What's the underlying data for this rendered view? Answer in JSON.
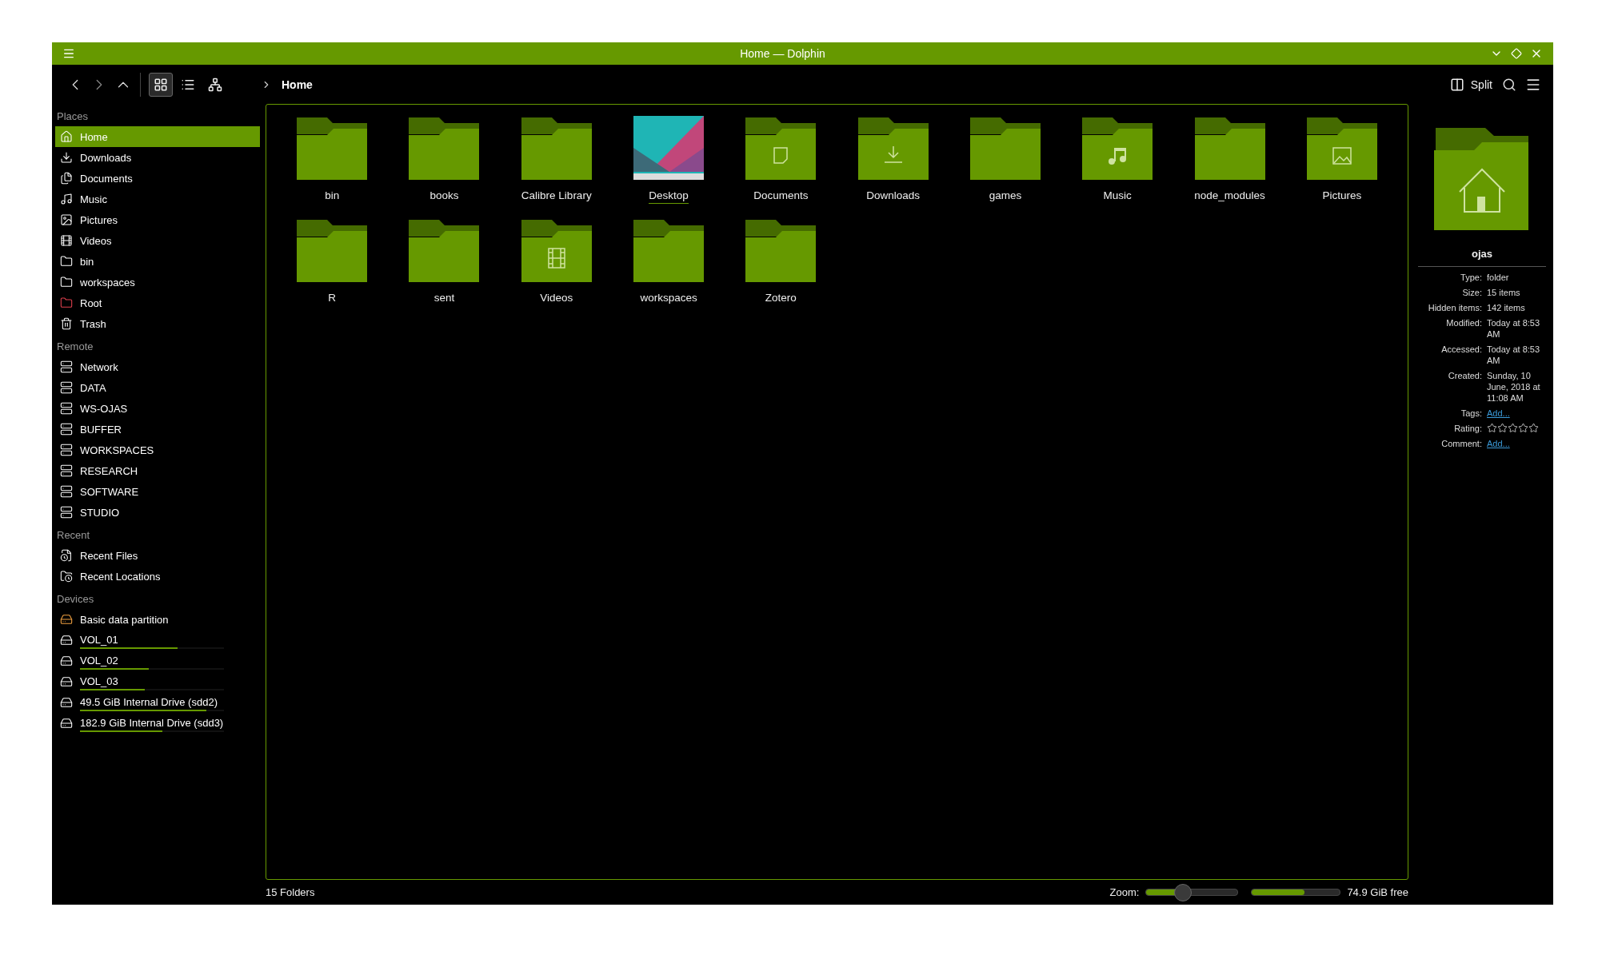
{
  "window": {
    "title": "Home — Dolphin"
  },
  "toolbar": {
    "view_modes": [
      {
        "kind": "icons",
        "selected": true
      },
      {
        "kind": "details",
        "selected": false
      },
      {
        "kind": "tree",
        "selected": false
      }
    ],
    "breadcrumb": [
      "Home"
    ],
    "split_label": "Split"
  },
  "sidebar": {
    "sections": [
      {
        "title": "Places",
        "items": [
          {
            "label": "Home",
            "kind": "home",
            "selected": true
          },
          {
            "label": "Downloads",
            "kind": "downloads",
            "selected": false
          },
          {
            "label": "Documents",
            "kind": "documents",
            "selected": false
          },
          {
            "label": "Music",
            "kind": "music",
            "selected": false
          },
          {
            "label": "Pictures",
            "kind": "pictures",
            "selected": false
          },
          {
            "label": "Videos",
            "kind": "videos",
            "selected": false
          },
          {
            "label": "bin",
            "kind": "folder",
            "selected": false
          },
          {
            "label": "workspaces",
            "kind": "folder",
            "selected": false
          },
          {
            "label": "Root",
            "kind": "root",
            "selected": false
          },
          {
            "label": "Trash",
            "kind": "trash",
            "selected": false
          }
        ]
      },
      {
        "title": "Remote",
        "items": [
          {
            "label": "Network",
            "kind": "network",
            "selected": false
          },
          {
            "label": "DATA",
            "kind": "network",
            "selected": false
          },
          {
            "label": "WS-OJAS",
            "kind": "network",
            "selected": false
          },
          {
            "label": "BUFFER",
            "kind": "network",
            "selected": false
          },
          {
            "label": "WORKSPACES",
            "kind": "network",
            "selected": false
          },
          {
            "label": "RESEARCH",
            "kind": "network",
            "selected": false
          },
          {
            "label": "SOFTWARE",
            "kind": "network",
            "selected": false
          },
          {
            "label": "STUDIO",
            "kind": "network",
            "selected": false
          }
        ]
      },
      {
        "title": "Recent",
        "items": [
          {
            "label": "Recent Files",
            "kind": "recent-files",
            "selected": false
          },
          {
            "label": "Recent Locations",
            "kind": "recent-locations",
            "selected": false
          }
        ]
      },
      {
        "title": "Devices",
        "items": [
          {
            "label": "Basic data partition",
            "kind": "partition",
            "selected": false
          },
          {
            "label": "VOL_01",
            "kind": "drive",
            "selected": false,
            "level": 0.68
          },
          {
            "label": "VOL_02",
            "kind": "drive",
            "selected": false,
            "level": 0.48
          },
          {
            "label": "VOL_03",
            "kind": "drive",
            "selected": false,
            "level": 0.45
          },
          {
            "label": "49.5 GiB Internal Drive (sdd2)",
            "kind": "drive",
            "selected": false,
            "level": 0.88
          },
          {
            "label": "182.9 GiB Internal Drive (sdd3)",
            "kind": "drive",
            "selected": false,
            "level": 0.57
          }
        ]
      }
    ]
  },
  "files": [
    {
      "name": "bin",
      "kind": "folder",
      "focused": false
    },
    {
      "name": "books",
      "kind": "folder",
      "focused": false
    },
    {
      "name": "Calibre Library",
      "kind": "folder",
      "focused": false
    },
    {
      "name": "Desktop",
      "kind": "thumbnail",
      "focused": true
    },
    {
      "name": "Documents",
      "kind": "documents",
      "focused": false
    },
    {
      "name": "Downloads",
      "kind": "downloads",
      "focused": false
    },
    {
      "name": "games",
      "kind": "folder",
      "focused": false
    },
    {
      "name": "Music",
      "kind": "music",
      "focused": false
    },
    {
      "name": "node_modules",
      "kind": "folder",
      "focused": false
    },
    {
      "name": "Pictures",
      "kind": "pictures",
      "focused": false
    },
    {
      "name": "R",
      "kind": "folder",
      "focused": false
    },
    {
      "name": "sent",
      "kind": "folder",
      "focused": false
    },
    {
      "name": "Videos",
      "kind": "videos",
      "focused": false
    },
    {
      "name": "workspaces",
      "kind": "folder",
      "focused": false
    },
    {
      "name": "Zotero",
      "kind": "folder",
      "focused": false
    }
  ],
  "info": {
    "name": "ojas",
    "rows": [
      {
        "label": "Type:",
        "kind": "text",
        "value": "folder"
      },
      {
        "label": "Size:",
        "kind": "text",
        "value": "15 items"
      },
      {
        "label": "Hidden items:",
        "kind": "text",
        "value": "142 items"
      },
      {
        "label": "Modified:",
        "kind": "text",
        "value": "Today at 8:53 AM"
      },
      {
        "label": "Accessed:",
        "kind": "text",
        "value": "Today at 8:53 AM"
      },
      {
        "label": "Created:",
        "kind": "text",
        "value": "Sunday, 10 June, 2018 at 11:08 AM"
      },
      {
        "label": "Tags:",
        "kind": "link",
        "value": "Add..."
      },
      {
        "label": "Rating:",
        "kind": "rating",
        "stars": 0
      },
      {
        "label": "Comment:",
        "kind": "link",
        "value": "Add..."
      }
    ]
  },
  "status_bar": {
    "summary": "15 Folders",
    "zoom_label": "Zoom:",
    "zoom": {
      "level": 0.38
    },
    "space": {
      "level": 0.6
    },
    "free_space": "74.9 GiB free"
  }
}
